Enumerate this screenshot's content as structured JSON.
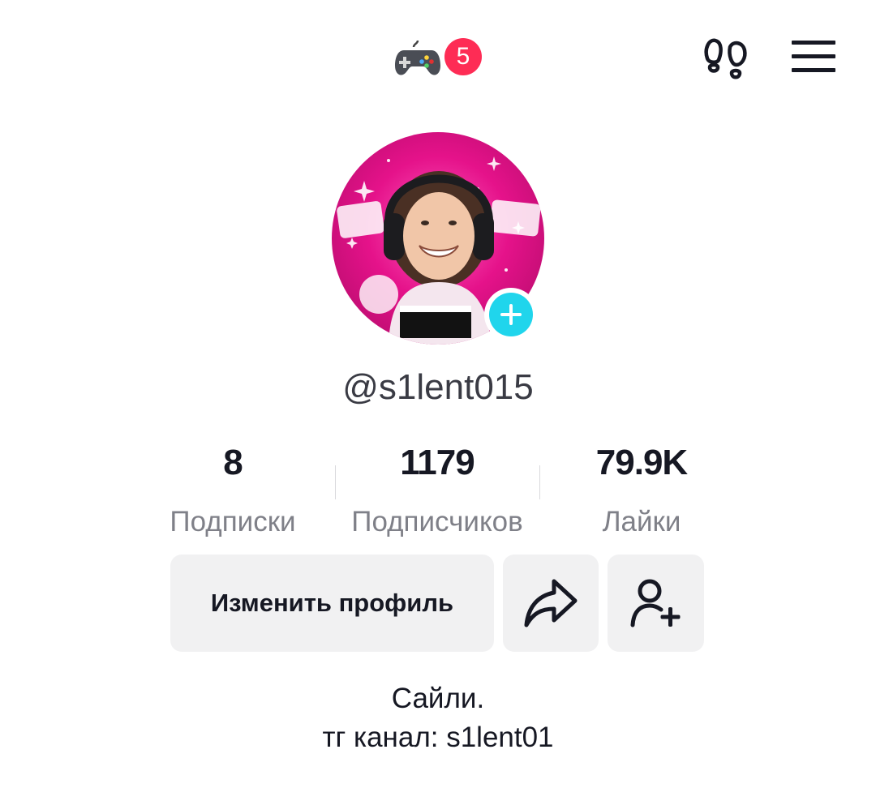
{
  "header": {
    "game_icon": "gamepad-icon",
    "notification_count": "5",
    "footprints_icon": "footprints-icon",
    "menu_icon": "hamburger-menu-icon",
    "badge_color": "#fe2c55"
  },
  "avatar": {
    "add_icon": "plus-icon",
    "add_color": "#20d5ec",
    "ring_color": "#e5128a"
  },
  "profile": {
    "username": "@s1lent015"
  },
  "stats": [
    {
      "value": "8",
      "label": "Подписки"
    },
    {
      "value": "1179",
      "label": "Подписчиков"
    },
    {
      "value": "79.9K",
      "label": "Лайки"
    }
  ],
  "actions": {
    "edit_label": "Изменить профиль",
    "share_icon": "share-arrow-icon",
    "add_friend_icon": "add-user-icon"
  },
  "bio": {
    "line1": "Сайли.",
    "line2": "тг канал: s1lent01"
  }
}
